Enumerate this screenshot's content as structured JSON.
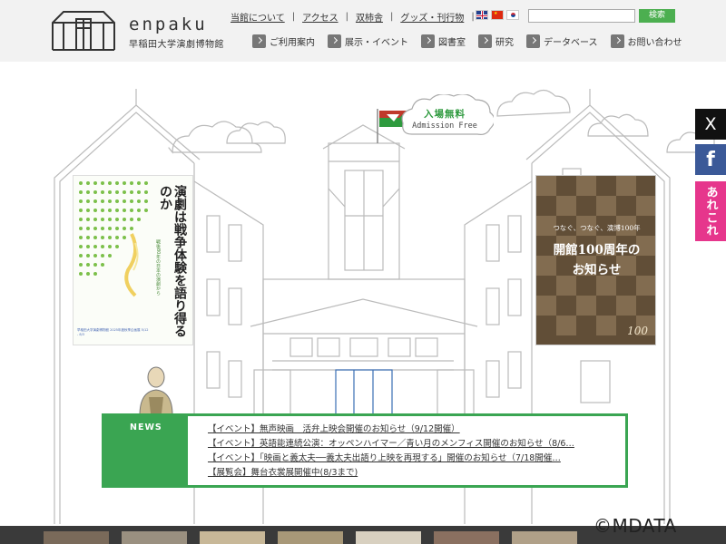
{
  "brand": {
    "word": "enpaku",
    "subtitle": "早稲田大学演劇博物館"
  },
  "top_nav": [
    {
      "label": "当館について"
    },
    {
      "label": "アクセス"
    },
    {
      "label": "双柿舎"
    },
    {
      "label": "グッズ・刊行物"
    }
  ],
  "languages": [
    "English",
    "中文",
    "한국어"
  ],
  "search": {
    "placeholder": "",
    "button_label": "検索"
  },
  "main_nav": [
    {
      "label": "ご利用案内",
      "icon": "chevron-right-icon"
    },
    {
      "label": "展示・イベント",
      "icon": "chevron-right-icon"
    },
    {
      "label": "図書室",
      "icon": "chevron-right-icon"
    },
    {
      "label": "研究",
      "icon": "chevron-right-icon"
    },
    {
      "label": "データベース",
      "icon": "chevron-right-icon"
    },
    {
      "label": "お問い合わせ",
      "icon": "chevron-right-icon"
    }
  ],
  "admission": {
    "jp": "入場無料",
    "en": "Admission Free"
  },
  "poster_left": {
    "title": "演劇は戦争体験を語り得るのか",
    "subtitle": "戦後80年の日本の演劇から",
    "footer": "早稲田大学演劇博物館 2025年度秋季企画展 5/12 - 8/3"
  },
  "poster_right": {
    "tagline": "つなぐ、つなぐ、演博100年",
    "title_line1": "開館100周年の",
    "title_line2": "お知らせ",
    "badge": "100"
  },
  "social": {
    "x_label": "X",
    "facebook_label": "f",
    "arekore_label": "あれこれ"
  },
  "news": {
    "label": "NEWS",
    "items": [
      "【イベント】無声映画　活弁上映会開催のお知らせ（9/12開催）",
      "【イベント】英語能連続公演：オッペンハイマー／青い月のメンフィス開催のお知らせ（8/6…",
      "【イベント】「映画と義太夫──義太夫出語り上映を再現する」開催のお知らせ（7/18開催…",
      "【展覧会】舞台衣裳展開催中(8/3まで)"
    ]
  },
  "watermark": "©MDATA",
  "colors": {
    "accent_green": "#3aa552",
    "header_bg": "#f2f2f2",
    "x_black": "#111111",
    "facebook_blue": "#3b5998",
    "arekore_pink": "#e6368c"
  }
}
